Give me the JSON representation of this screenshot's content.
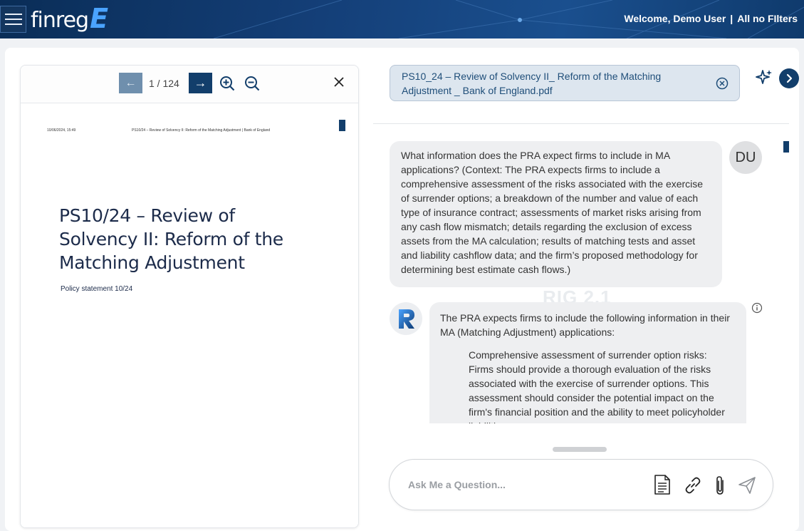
{
  "header": {
    "logo_text": "finreg",
    "logo_letter": "E",
    "welcome": "Welcome, Demo User",
    "separator": "|",
    "filters": "All no FIlters"
  },
  "pdf_viewer": {
    "prev_glyph": "←",
    "next_glyph": "→",
    "page_indicator": "1 / 124",
    "page_header_left": "10/06/2024, 15:49",
    "page_header_center": "PS10/24 – Review of Solvency II: Reform of the Matching Adjustment | Bank of England",
    "doc_title": "PS10/24 – Review of Solvency II: Reform of the Matching Adjustment",
    "doc_subtitle": "Policy statement 10/24"
  },
  "chat": {
    "file_chip": "PS10_24 – Review of Solvency II_ Reform of the Matching Adjustment _ Bank of England.pdf",
    "user_initials": "DU",
    "user_message": "What information does the PRA expect firms to include in MA applications? (Context: The PRA expects firms to include a comprehensive assessment of the risks associated with the exercise of surrender options; a breakdown of the number and value of each type of insurance contract; assessments of market risks arising from any cash flow mismatch; details regarding the exclusion of excess assets from the MA calculation; results of matching tests and asset and liability cashflow data; and the firm’s proposed methodology for determining best estimate cash flows.)",
    "watermark": "RIG 2.1",
    "bot_intro": "The PRA expects firms to include the following information in their MA (Matching Adjustment) applications:",
    "bot_point": "Comprehensive assessment of surrender option risks: Firms should provide a thorough evaluation of the risks associated with the exercise of surrender options. This assessment should consider the potential impact on the firm's financial position and the ability to meet policyholder liabilities.",
    "input_placeholder": "Ask Me a Question..."
  },
  "icons": {
    "menu": "hamburger-icon",
    "zoom_in": "zoom-in-icon",
    "zoom_out": "zoom-out-icon",
    "close": "close-icon",
    "remove_file": "circle-x-icon",
    "sparkle": "sparkle-icon",
    "expand": "chevron-right-icon",
    "info": "info-icon",
    "doc": "document-icon",
    "link": "link-icon",
    "attach": "paperclip-icon",
    "send": "send-icon"
  },
  "colors": {
    "header_bg": "#143f78",
    "brand_navy": "#123e6b",
    "logo_accent": "#4aa3ff",
    "chip_bg": "#dde6ef",
    "bubble_bg": "#eeeff1"
  }
}
